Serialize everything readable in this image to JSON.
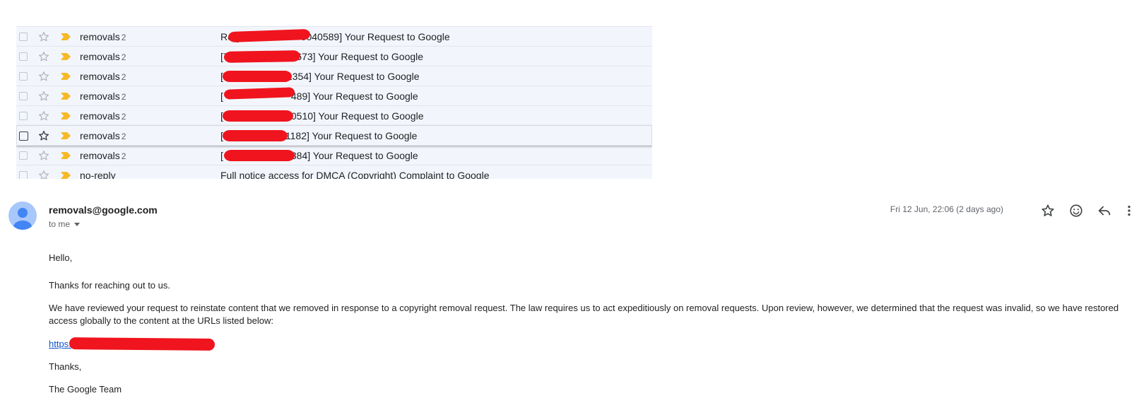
{
  "inbox": {
    "rows": [
      {
        "sender": "removals",
        "count": "2",
        "subject_prefix": "Re:[",
        "subject_suffix": "0040589] Your Request to Google"
      },
      {
        "sender": "removals",
        "count": "2",
        "subject_prefix": "[7",
        "subject_suffix": "40673] Your Request to Google"
      },
      {
        "sender": "removals",
        "count": "2",
        "subject_prefix": "[",
        "subject_suffix": "1354] Your Request to Google"
      },
      {
        "sender": "removals",
        "count": "2",
        "subject_prefix": "[",
        "subject_suffix": "489] Your Request to Google"
      },
      {
        "sender": "removals",
        "count": "2",
        "subject_prefix": "[",
        "subject_suffix": "0510] Your Request to Google"
      },
      {
        "sender": "removals",
        "count": "2",
        "subject_prefix": "[",
        "subject_suffix": "1182] Your Request to Google"
      },
      {
        "sender": "removals",
        "count": "2",
        "subject_prefix": "[",
        "subject_suffix": "384] Your Request to Google"
      },
      {
        "sender": "no-reply",
        "count": "",
        "subject_prefix": "",
        "subject_suffix": "Full notice access for DMCA (Copyright) Complaint to Google"
      }
    ]
  },
  "email": {
    "from": "removals@google.com",
    "to_label": "to me",
    "date": "Fri 12 Jun, 22:06 (2 days ago)",
    "greeting": "Hello,",
    "thanks_reach": "Thanks for reaching out to us.",
    "body": "We have reviewed your request to reinstate content that we removed in response to a copyright removal request. The law requires us to act expeditiously on removal requests. Upon review, however, we determined that the request was invalid, so we have restored access globally to the content at the URLs listed below:",
    "link_text": "https:",
    "signoff": "Thanks,",
    "signature": "The Google Team"
  },
  "colors": {
    "redaction": "#f0141e",
    "importance": "#f7b928",
    "link": "#1155cc",
    "avatar": "#a8c7fa",
    "avatar_figure": "#4285f4"
  },
  "icons": {
    "row_star": "star-outline-icon",
    "row_importance": "importance-marker-icon",
    "email_star": "star-icon",
    "email_emoji": "emoji-reaction-icon",
    "email_reply": "reply-icon",
    "email_more": "more-vertical-icon",
    "recipient_dropdown": "chevron-down-icon"
  }
}
